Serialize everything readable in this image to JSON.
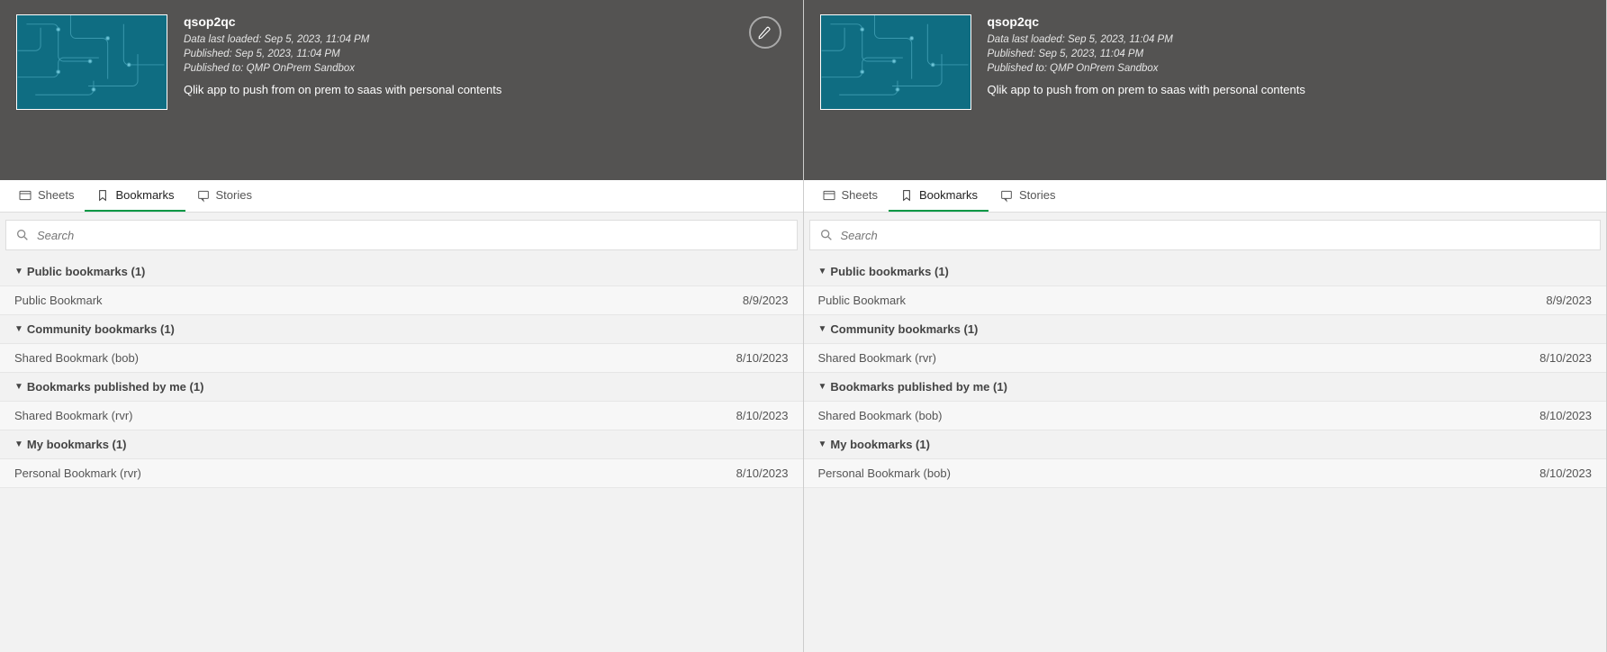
{
  "left": {
    "app": {
      "title": "qsop2qc",
      "data_loaded": "Data last loaded: Sep 5, 2023, 11:04 PM",
      "published": "Published: Sep 5, 2023, 11:04 PM",
      "published_to": "Published to: QMP OnPrem Sandbox",
      "description": "Qlik app to push from on prem to saas with personal contents"
    },
    "tabs": {
      "sheets": "Sheets",
      "bookmarks": "Bookmarks",
      "stories": "Stories",
      "active": "bookmarks"
    },
    "search": {
      "placeholder": "Search"
    },
    "groups": [
      {
        "label": "Public bookmarks (1)",
        "items": [
          {
            "name": "Public Bookmark",
            "date": "8/9/2023"
          }
        ]
      },
      {
        "label": "Community bookmarks (1)",
        "items": [
          {
            "name": "Shared Bookmark (bob)",
            "date": "8/10/2023"
          }
        ]
      },
      {
        "label": "Bookmarks published by me (1)",
        "items": [
          {
            "name": "Shared Bookmark (rvr)",
            "date": "8/10/2023"
          }
        ]
      },
      {
        "label": "My bookmarks (1)",
        "items": [
          {
            "name": "Personal Bookmark (rvr)",
            "date": "8/10/2023"
          }
        ]
      }
    ]
  },
  "right": {
    "app": {
      "title": "qsop2qc",
      "data_loaded": "Data last loaded: Sep 5, 2023, 11:04 PM",
      "published": "Published: Sep 5, 2023, 11:04 PM",
      "published_to": "Published to: QMP OnPrem Sandbox",
      "description": "Qlik app to push from on prem to saas with personal contents"
    },
    "tabs": {
      "sheets": "Sheets",
      "bookmarks": "Bookmarks",
      "stories": "Stories",
      "active": "bookmarks"
    },
    "search": {
      "placeholder": "Search"
    },
    "groups": [
      {
        "label": "Public bookmarks (1)",
        "items": [
          {
            "name": "Public Bookmark",
            "date": "8/9/2023"
          }
        ]
      },
      {
        "label": "Community bookmarks (1)",
        "items": [
          {
            "name": "Shared Bookmark (rvr)",
            "date": "8/10/2023"
          }
        ]
      },
      {
        "label": "Bookmarks published by me (1)",
        "items": [
          {
            "name": "Shared Bookmark (bob)",
            "date": "8/10/2023"
          }
        ]
      },
      {
        "label": "My bookmarks (1)",
        "items": [
          {
            "name": "Personal Bookmark (bob)",
            "date": "8/10/2023"
          }
        ]
      }
    ]
  }
}
